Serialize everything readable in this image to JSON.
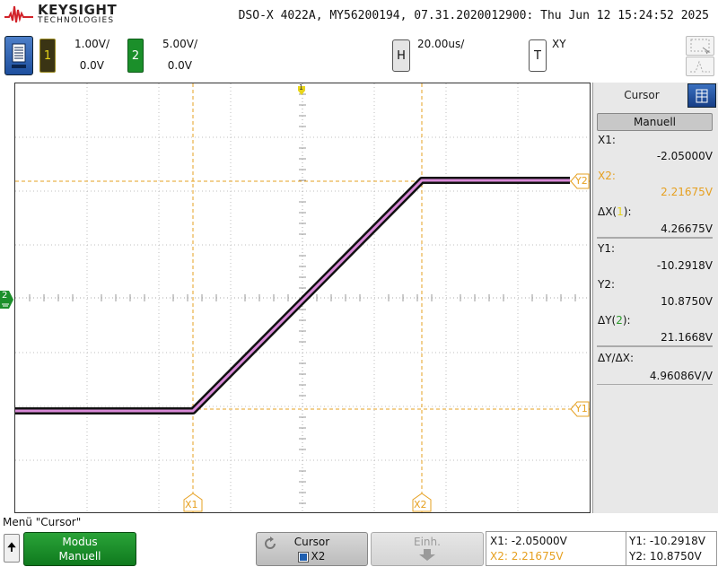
{
  "header": {
    "brand": "KEYSIGHT",
    "brand_sub": "TECHNOLOGIES",
    "model_line": "DSO-X 4022A, MY56200194, 07.31.2020012900: Thu Jun 12 15:24:52 2025"
  },
  "channels": [
    {
      "number": "1",
      "scale": "1.00V/",
      "offset": "0.0V",
      "color": "#e8d51a"
    },
    {
      "number": "2",
      "scale": "5.00V/",
      "offset": "0.0V",
      "color": "#1b8f2a"
    }
  ],
  "horizontal": {
    "key": "H",
    "scale": "20.00us/"
  },
  "trigger": {
    "key": "T",
    "mode": "XY"
  },
  "screen": {
    "trigger_marker": "1",
    "ch2_marker": "2",
    "cursor_labels": {
      "x1": "X1",
      "x2": "X2",
      "y1": "Y1",
      "y2": "Y2"
    },
    "cursor_color": "#e6a020",
    "trace_color": "#d98ad8"
  },
  "cursor_panel": {
    "tab_label": "Cursor",
    "mode": "Manuell",
    "rows": [
      {
        "label": "X1:",
        "value": "-2.05000V",
        "highlight": false
      },
      {
        "label": "X2:",
        "value": "2.21675V",
        "highlight": true
      },
      {
        "label_prefix": "ΔX(",
        "label_num": "1",
        "label_suffix": "):",
        "value": "4.26675V"
      },
      {
        "label": "Y1:",
        "value": "-10.2918V",
        "highlight": false
      },
      {
        "label": "Y2:",
        "value": "10.8750V",
        "highlight": false
      },
      {
        "label_prefix": "ΔY(",
        "label_num": "2",
        "label_suffix": "):",
        "value": "21.1668V"
      },
      {
        "label": "ΔY/ΔX:",
        "value": "4.96086V/V",
        "highlight": false
      }
    ]
  },
  "menu": {
    "title": "Menü \"Cursor\"",
    "modus_label": "Modus",
    "modus_value": "Manuell",
    "cursor_label": "Cursor",
    "cursor_value": "X2",
    "einh_label": "Einh."
  },
  "readout": {
    "x1": "X1: -2.05000V",
    "x2": "X2: 2.21675V",
    "y1": "Y1: -10.2918V",
    "y2": "Y2: 10.8750V"
  }
}
